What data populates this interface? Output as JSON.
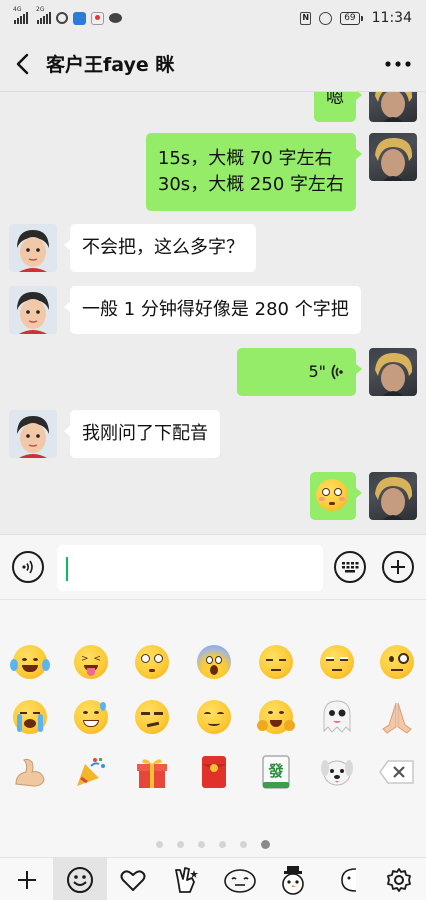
{
  "status_bar": {
    "signal1_tag": "4G",
    "signal2_tag": "2G",
    "battery": "69",
    "time": "11:34"
  },
  "header": {
    "title": "客户王faye 眯"
  },
  "messages": [
    {
      "side": "me",
      "text": "嗯"
    },
    {
      "side": "me",
      "lines": [
        "15s，大概 70 字左右",
        "30s，大概 250 字左右"
      ]
    },
    {
      "side": "other",
      "text": "不会把，这么多字？"
    },
    {
      "side": "other",
      "text": "一般 1 分钟得好像是 280 个字把"
    },
    {
      "side": "me",
      "type": "voice",
      "duration": "5\""
    },
    {
      "side": "other",
      "text": "我刚问了下配音"
    },
    {
      "side": "me",
      "type": "emoji",
      "emoji": "flushed-face"
    }
  ],
  "input": {
    "value": "",
    "placeholder": ""
  },
  "emoji_panel": {
    "rows": [
      [
        "face-with-tears-of-joy",
        "squinting-face-with-tongue",
        "flushed-face",
        "face-screaming-in-fear",
        "pensive-face",
        "unamused-face",
        "face-with-monocle"
      ],
      [
        "loudly-crying-face",
        "grinning-face-with-sweat",
        "smirking-face",
        "smiling-face",
        "hugging-face",
        "ghost",
        "folded-hands"
      ],
      [
        "flexed-biceps",
        "party-popper",
        "wrapped-gift",
        "red-envelope",
        "mahjong-fa",
        "dog-face",
        "backspace-key"
      ]
    ],
    "page_count": 6,
    "active_page": 5
  },
  "tabbar": {
    "items": [
      "add-icon",
      "emoji-smile-icon",
      "heart-icon",
      "hand-v-sticker",
      "sticker-face-1",
      "sticker-snowman",
      "sticker-face-2",
      "settings-gear-icon"
    ],
    "active_index": 1
  },
  "colors": {
    "bubble_me": "#95ec69",
    "bubble_other": "#ffffff",
    "chat_bg": "#ededed",
    "accent": "#07c160"
  }
}
